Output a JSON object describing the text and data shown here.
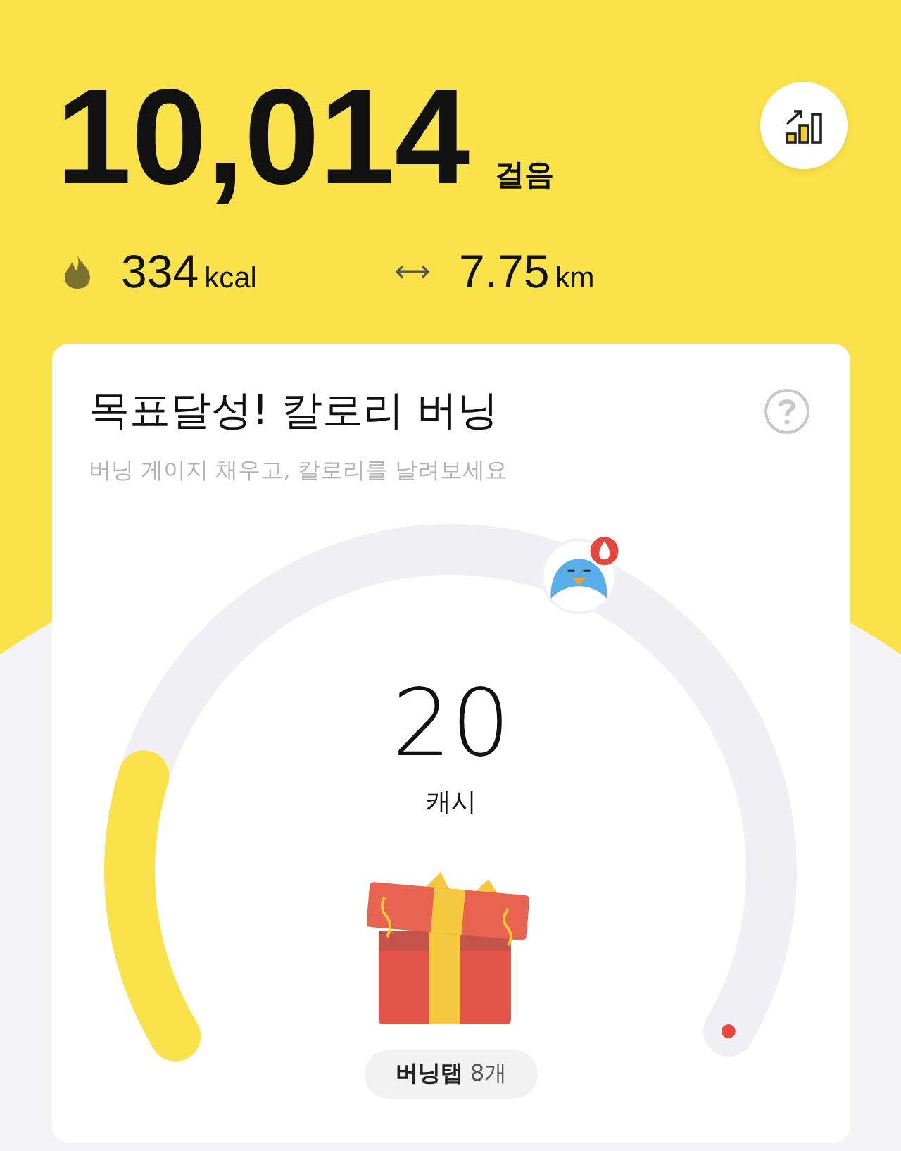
{
  "steps": {
    "value": "10,014",
    "unit": "걸음"
  },
  "calories": {
    "value": "334",
    "unit": "kcal"
  },
  "distance": {
    "value": "7.75",
    "unit": "km"
  },
  "card": {
    "title": "목표달성! 칼로리 버닝",
    "subtitle": "버닝 게이지 채우고, 칼로리를 날려보세요",
    "reward": {
      "value": "20",
      "unit": "캐시"
    },
    "burning_taps": "**버닝탭** 8개"
  }
}
